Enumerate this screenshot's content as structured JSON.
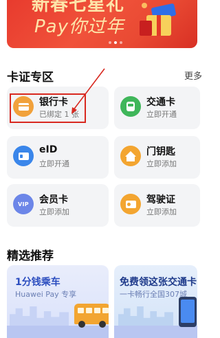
{
  "banner": {
    "line1": "新春七星礼",
    "line2": "Pay你过年"
  },
  "cards_section": {
    "title": "卡证专区",
    "more_label": "更多",
    "cards": [
      {
        "title": "银行卡",
        "subtitle": "已绑定 1 张",
        "icon": "bank-card-icon"
      },
      {
        "title": "交通卡",
        "subtitle": "立即开通",
        "icon": "transit-card-icon"
      },
      {
        "title": "eID",
        "subtitle": "立即开通",
        "icon": "eid-icon"
      },
      {
        "title": "门钥匙",
        "subtitle": "立即添加",
        "icon": "door-key-icon"
      },
      {
        "title": "会员卡",
        "subtitle": "立即添加",
        "icon": "vip-card-icon",
        "badge": "VIP"
      },
      {
        "title": "驾驶证",
        "subtitle": "立即添加",
        "icon": "driver-license-icon"
      }
    ]
  },
  "recommend_section": {
    "title": "精选推荐",
    "items": [
      {
        "title": "1分钱乘车",
        "subtitle": "Huawei Pay 专享"
      },
      {
        "title": "免费领这张交通卡",
        "subtitle": "一卡畅行全国307城"
      }
    ]
  },
  "colors": {
    "banner_red": "#e83b2e",
    "highlight_red": "#d8281f",
    "bank_orange": "#f1a13b",
    "transit_green": "#3fb65a",
    "eid_blue": "#3a86ea",
    "vip_blue": "#6c86e8"
  }
}
